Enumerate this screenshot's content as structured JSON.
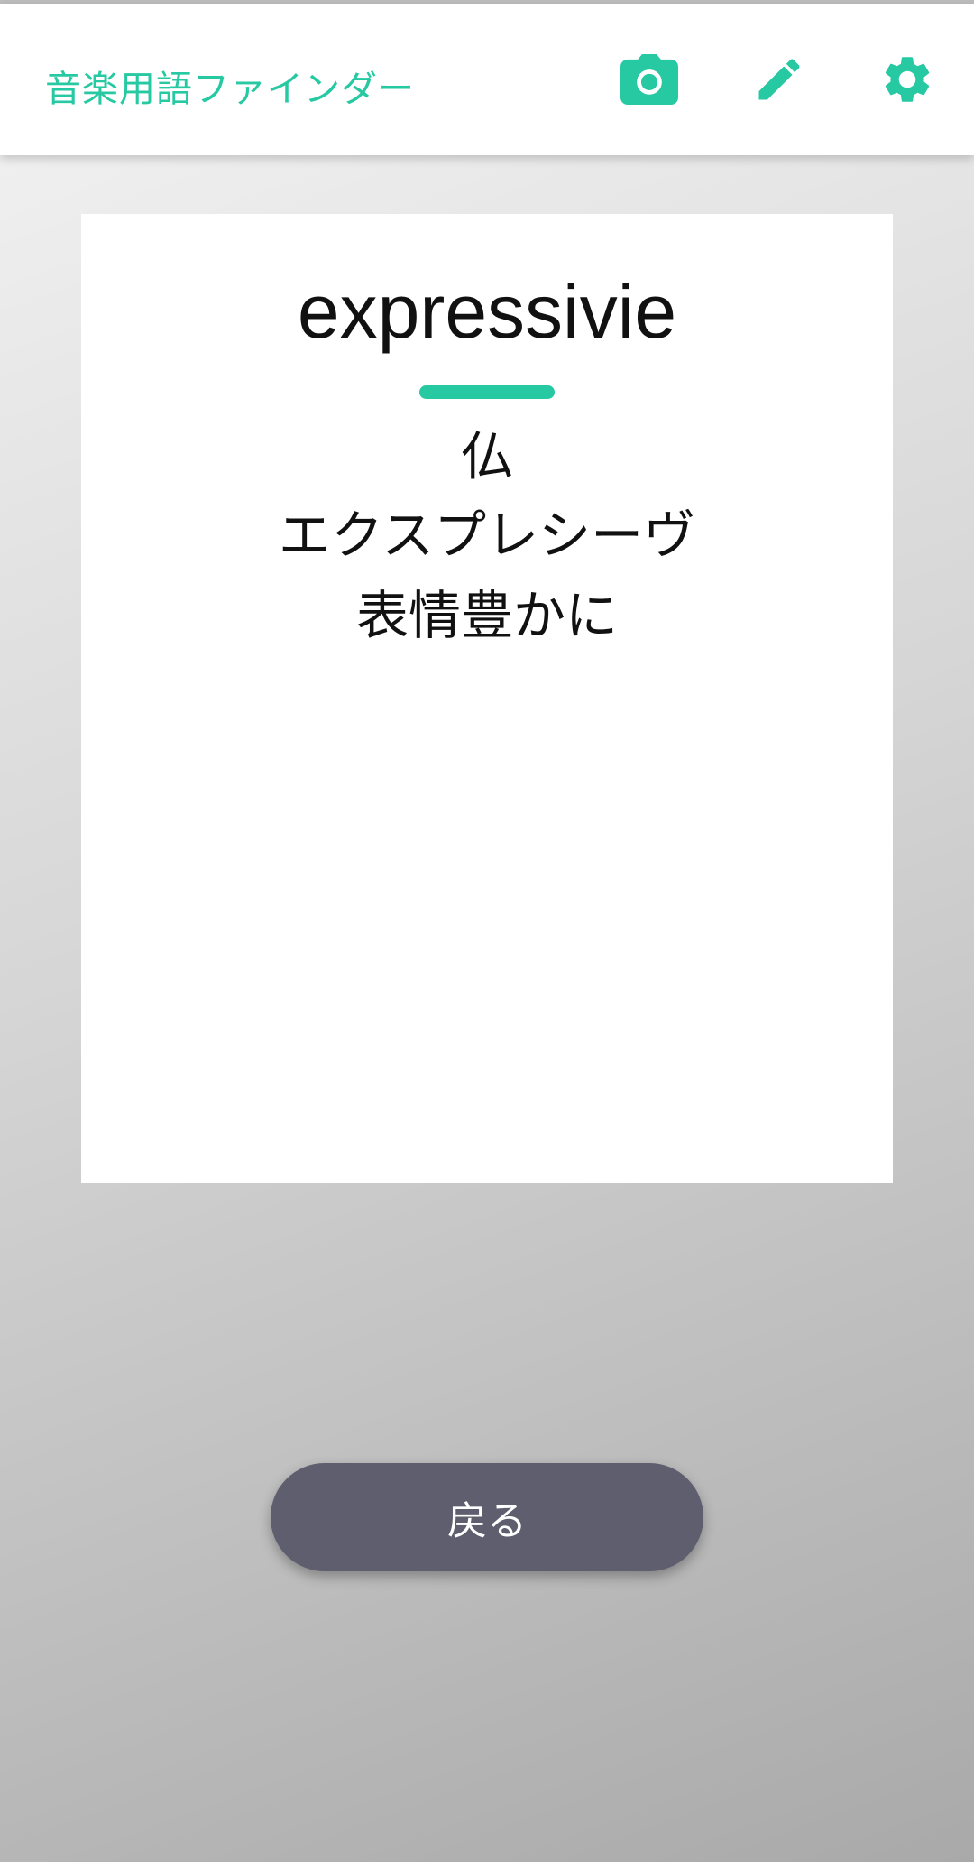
{
  "app_bar": {
    "title": "音楽用語ファインダー",
    "accent_color": "#26c9a1",
    "actions": [
      {
        "name": "camera",
        "icon": "camera-icon"
      },
      {
        "name": "edit",
        "icon": "pencil-icon"
      },
      {
        "name": "settings",
        "icon": "gear-icon"
      }
    ]
  },
  "term_card": {
    "term": "expressivie",
    "origin": "仏",
    "reading": "エクスプレシーヴ",
    "meaning": "表情豊かに"
  },
  "footer": {
    "back_label": "戻る",
    "button_color": "#5f5e6f"
  }
}
